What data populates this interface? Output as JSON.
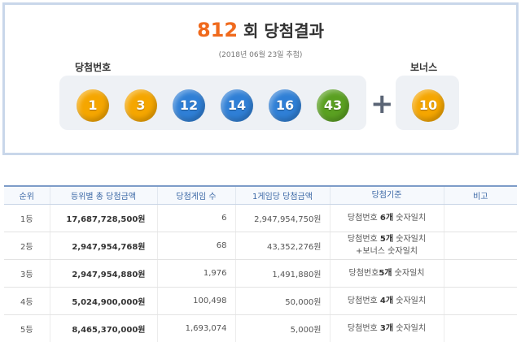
{
  "draw": {
    "round_number": "812",
    "round_suffix": "회 당첨결과",
    "date_text": "(2018년 06월 23일 추첨)",
    "winning_label": "당첨번호",
    "bonus_label": "보너스",
    "plus_symbol": "+",
    "numbers": [
      {
        "value": "1",
        "color": "#f5a600"
      },
      {
        "value": "3",
        "color": "#f5a600"
      },
      {
        "value": "12",
        "color": "#2f7fd6"
      },
      {
        "value": "14",
        "color": "#2f7fd6"
      },
      {
        "value": "16",
        "color": "#2f7fd6"
      },
      {
        "value": "43",
        "color": "#5aa021"
      }
    ],
    "bonus": {
      "value": "10",
      "color": "#f5a600"
    }
  },
  "table": {
    "headers": [
      "순위",
      "등위별 총 당첨금액",
      "당첨게임 수",
      "1게임당 당첨금액",
      "당첨기준",
      "비고"
    ],
    "rows": [
      {
        "rank": "1등",
        "total": "17,687,728,500원",
        "count": "6",
        "per_game": "2,947,954,750원",
        "crit_a": "당첨번호 ",
        "crit_b": "6개",
        "crit_c": " 숫자일치",
        "crit_line2": "",
        "note": ""
      },
      {
        "rank": "2등",
        "total": "2,947,954,768원",
        "count": "68",
        "per_game": "43,352,276원",
        "crit_a": "당첨번호 ",
        "crit_b": "5개",
        "crit_c": " 숫자일치",
        "crit_line2": "+보너스 숫자일치",
        "note": ""
      },
      {
        "rank": "3등",
        "total": "2,947,954,880원",
        "count": "1,976",
        "per_game": "1,491,880원",
        "crit_a": "당첨번호",
        "crit_b": "5개",
        "crit_c": " 숫자일치",
        "crit_line2": "",
        "note": ""
      },
      {
        "rank": "4등",
        "total": "5,024,900,000원",
        "count": "100,498",
        "per_game": "50,000원",
        "crit_a": "당첨번호 ",
        "crit_b": "4개",
        "crit_c": " 숫자일치",
        "crit_line2": "",
        "note": ""
      },
      {
        "rank": "5등",
        "total": "8,465,370,000원",
        "count": "1,693,074",
        "per_game": "5,000원",
        "crit_a": "당첨번호 ",
        "crit_b": "3개",
        "crit_c": " 숫자일치",
        "crit_line2": "",
        "note": ""
      }
    ]
  }
}
